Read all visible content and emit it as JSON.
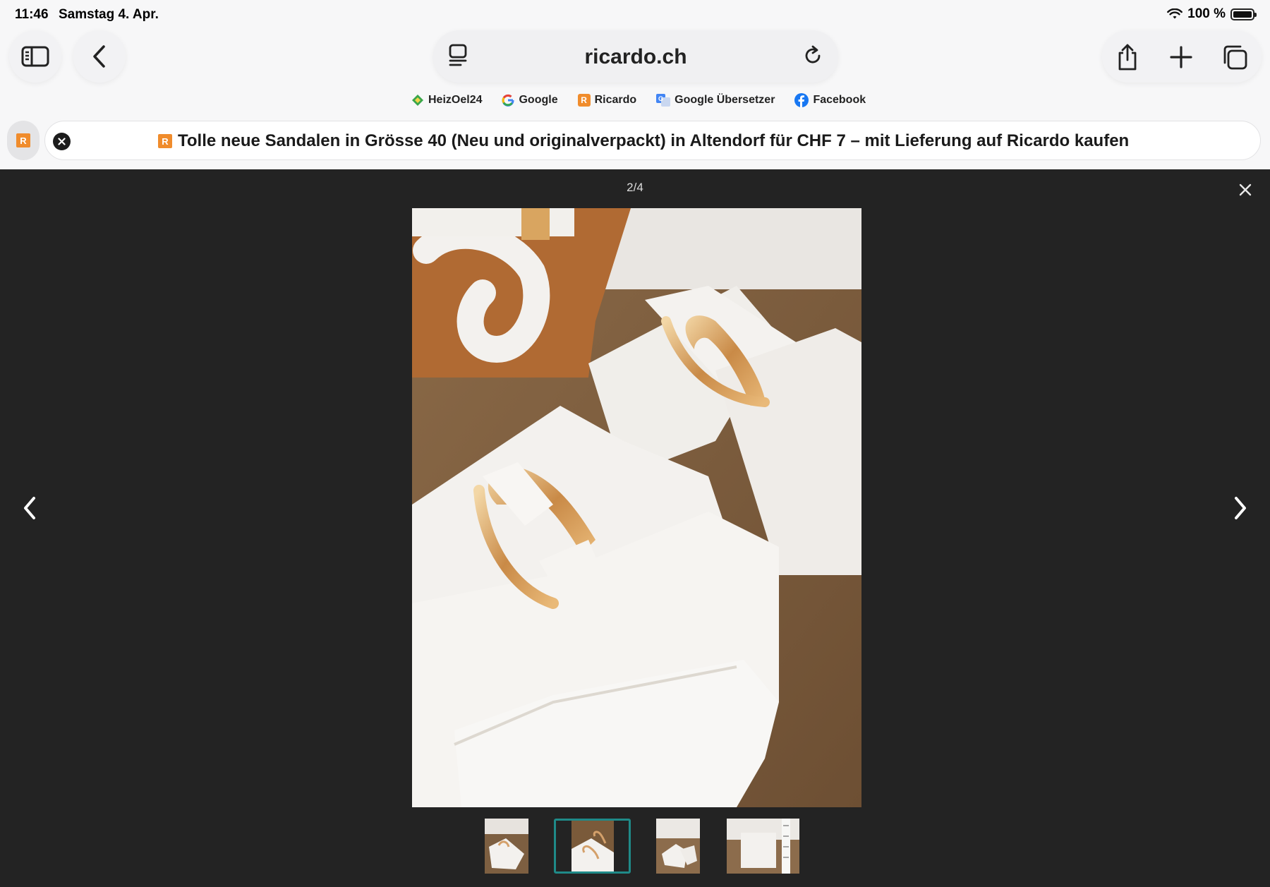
{
  "status_bar": {
    "time": "11:46",
    "date": "Samstag 4. Apr.",
    "battery": "100 %",
    "battery_level": 1.0
  },
  "toolbar": {
    "sidebar_icon": "sidebar-icon",
    "back_icon": "chevron-left-icon",
    "address": "ricardo.ch",
    "reader_icon": "reader-icon",
    "reload_icon": "reload-icon",
    "share_icon": "share-icon",
    "new_tab_icon": "plus-icon",
    "tabs_icon": "tabs-icon"
  },
  "favorites": [
    {
      "label": "HeizOel24",
      "icon": "heizoel-icon"
    },
    {
      "label": "Google",
      "icon": "google-icon"
    },
    {
      "label": "Ricardo",
      "icon": "ricardo-icon"
    },
    {
      "label": "Google Übersetzer",
      "icon": "translate-icon"
    },
    {
      "label": "Facebook",
      "icon": "facebook-icon"
    }
  ],
  "tab": {
    "favicon_letter": "R",
    "title": "Tolle neue Sandalen in Grösse 40 (Neu und originalverpackt) in Altendorf für CHF 7 – mit Lieferung auf Ricardo kaufen"
  },
  "viewer": {
    "counter": "2/4",
    "current_index": 2,
    "total": 4,
    "selected_thumb_color": "#1f8a88",
    "background_color": "#232323"
  },
  "colors": {
    "ricardo_orange": "#f08c2c"
  }
}
